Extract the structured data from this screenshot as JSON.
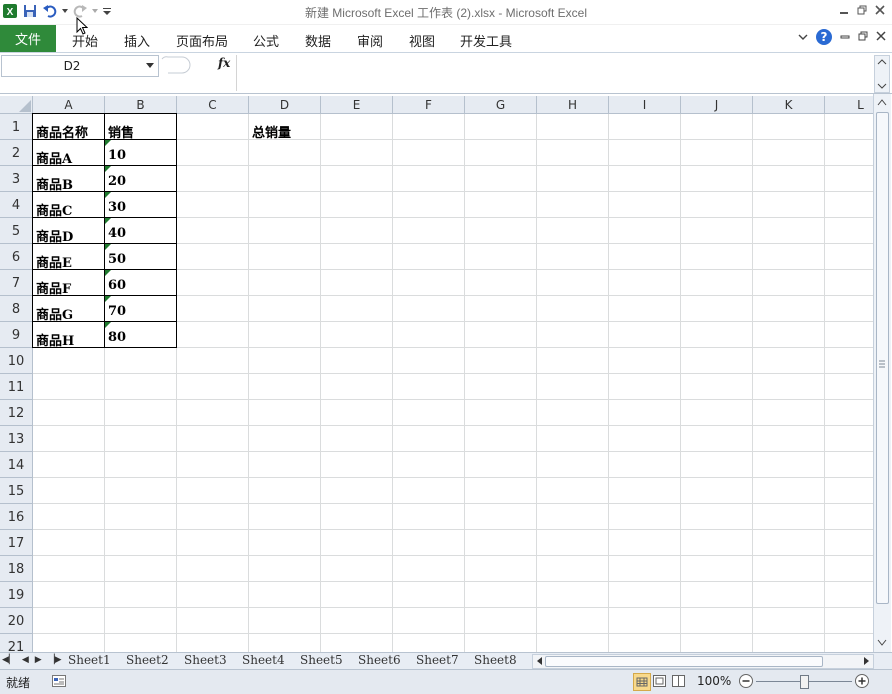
{
  "window": {
    "title": "新建 Microsoft Excel 工作表 (2).xlsx  -  Microsoft Excel"
  },
  "ribbon": {
    "file_label": "文件",
    "tabs": [
      "开始",
      "插入",
      "页面布局",
      "公式",
      "数据",
      "审阅",
      "视图",
      "开发工具"
    ]
  },
  "formula_bar": {
    "name_box": "D2",
    "fx_label": "fx",
    "content": ""
  },
  "columns": [
    "A",
    "B",
    "C",
    "D",
    "E",
    "F",
    "G",
    "H",
    "I",
    "J",
    "K",
    "L"
  ],
  "rows": [
    "1",
    "2",
    "3",
    "4",
    "5",
    "6",
    "7",
    "8",
    "9",
    "10",
    "11",
    "12",
    "13",
    "14",
    "15",
    "16",
    "17",
    "18",
    "19",
    "20",
    "21"
  ],
  "cells": {
    "A1": "商品名称",
    "B1": "销售",
    "D1": "总销量",
    "A2": "商品A",
    "B2": "10",
    "A3": "商品B",
    "B3": "20",
    "A4": "商品C",
    "B4": "30",
    "A5": "商品D",
    "B5": "40",
    "A6": "商品E",
    "B6": "50",
    "A7": "商品F",
    "B7": "60",
    "A8": "商品G",
    "B8": "70",
    "A9": "商品H",
    "B9": "80"
  },
  "sheets": [
    "Sheet1",
    "Sheet2",
    "Sheet3",
    "Sheet4",
    "Sheet5",
    "Sheet6",
    "Sheet7",
    "Sheet8"
  ],
  "status": {
    "ready": "就绪",
    "zoom": "100%"
  },
  "colors": {
    "file_tab": "#2f8a3a",
    "header_bg": "#e6ebf2",
    "gridline": "#dadcdd",
    "number_marker": "#1f7a2e"
  }
}
